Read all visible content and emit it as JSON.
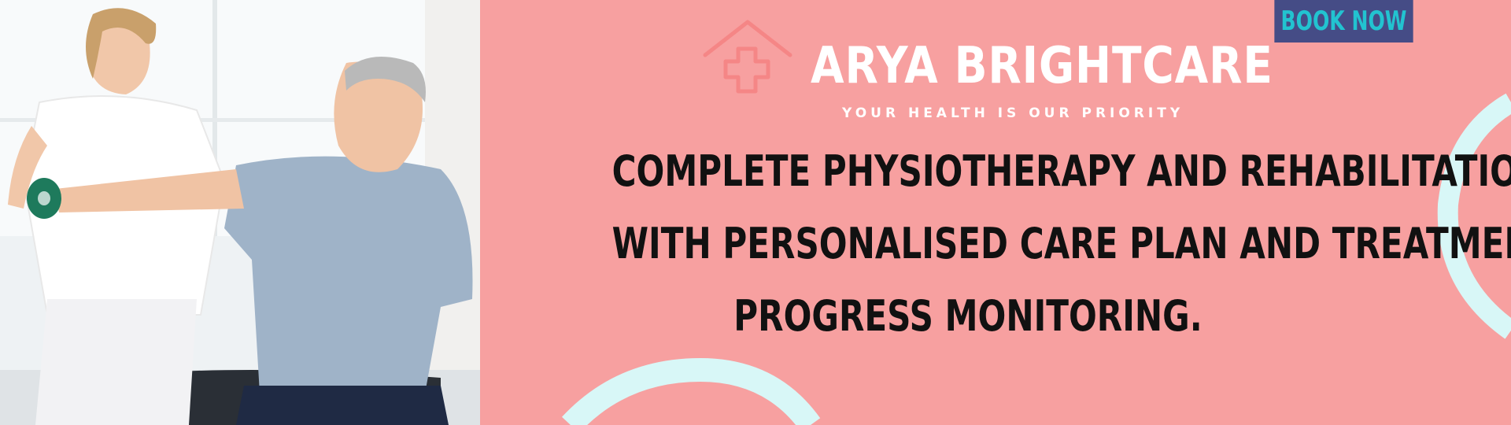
{
  "book_button": {
    "label": "BOOK NOW"
  },
  "brand": {
    "name": "ARYA BRIGHTCARE",
    "tagline": "YOUR HEALTH IS OUR PRIORITY"
  },
  "headline": {
    "lines": [
      "COMPLETE PHYSIOTHERAPY AND REHABILITATION",
      "WITH PERSONALISED CARE PLAN AND TREATMENT",
      "PROGRESS MONITORING."
    ]
  },
  "colors": {
    "background": "#f7a0a0",
    "button_bg": "#454c86",
    "button_text": "#22c3d0",
    "accent_wave": "#d8f7f7",
    "headline_text": "#111111"
  },
  "icons": {
    "logo": "house-with-cross-icon"
  }
}
